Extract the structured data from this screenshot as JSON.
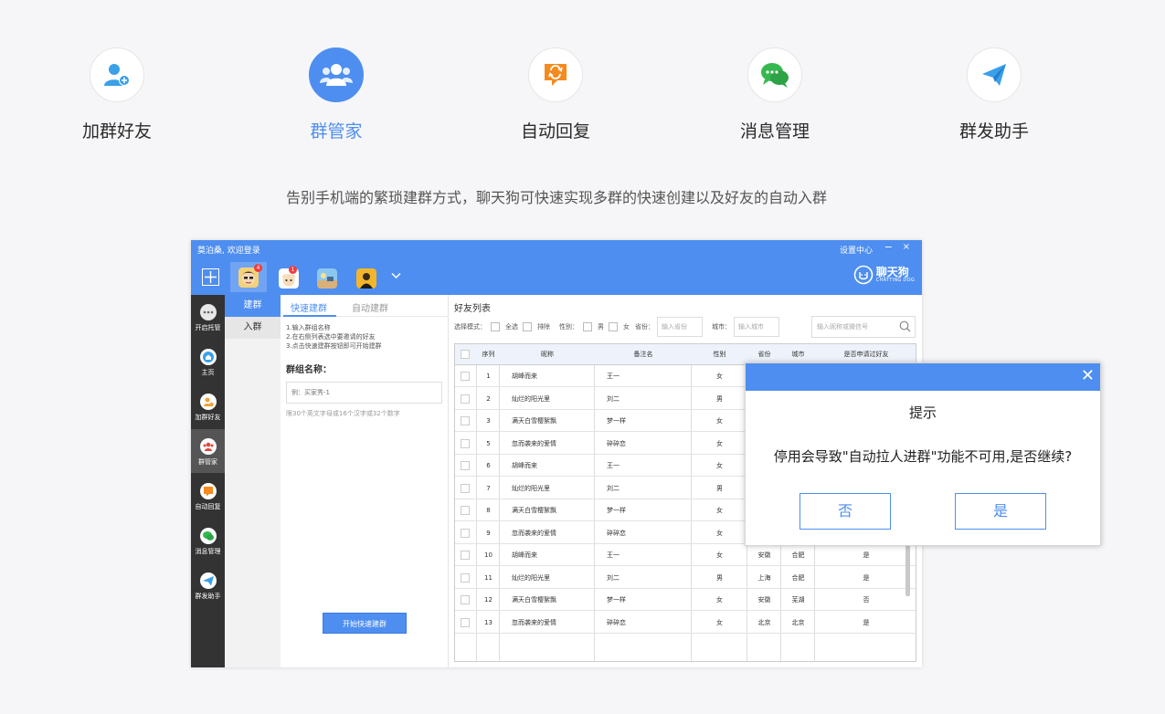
{
  "features": [
    {
      "label": "加群好友",
      "icon": "add-friend-icon",
      "active": false
    },
    {
      "label": "群管家",
      "icon": "group-manager-icon",
      "active": true
    },
    {
      "label": "自动回复",
      "icon": "auto-reply-icon",
      "active": false
    },
    {
      "label": "消息管理",
      "icon": "message-icon",
      "active": false
    },
    {
      "label": "群发助手",
      "icon": "paper-plane-icon",
      "active": false
    }
  ],
  "tagline": "告别手机端的繁琐建群方式，聊天狗可快速实现多群的快速创建以及好友的自动入群",
  "window": {
    "title": "莫泊桑, 欢迎登录",
    "settings": "设置中心",
    "min": "−",
    "close": "×",
    "logo_text": "聊天狗",
    "logo_sub": "CHATTING DOG",
    "accounts": [
      {
        "badge": "4",
        "selected": true
      },
      {
        "badge": "1",
        "selected": false
      },
      {
        "badge": "",
        "selected": false
      },
      {
        "badge": "",
        "selected": false
      }
    ]
  },
  "sidebar": [
    {
      "label": "开启托管",
      "icon": "ellipsis-icon",
      "selected": false
    },
    {
      "label": "主页",
      "icon": "home-icon",
      "selected": false
    },
    {
      "label": "加群好友",
      "icon": "add-friend-icon",
      "selected": false
    },
    {
      "label": "群管家",
      "icon": "group-manager-icon",
      "selected": true
    },
    {
      "label": "自动回复",
      "icon": "auto-reply-icon",
      "selected": false
    },
    {
      "label": "消息管理",
      "icon": "message-icon",
      "selected": false
    },
    {
      "label": "群发助手",
      "icon": "paper-plane-icon",
      "selected": false
    }
  ],
  "submenu": [
    {
      "label": "建群",
      "selected": true
    },
    {
      "label": "入群",
      "selected": false
    }
  ],
  "create": {
    "tab_fast": "快速建群",
    "tab_auto": "自动建群",
    "step1": "1.输入群组名称",
    "step2": "2.在右侧列表选中要邀请的好友",
    "step3": "3.点击快速建群按钮即可开始建群",
    "group_name_label": "群组名称：",
    "group_name_placeholder": "例：买家秀-1",
    "hint": "限30个英文字母或16个汉字或32个数字",
    "start_button": "开始快速建群"
  },
  "friends": {
    "title": "好友列表",
    "mode_label": "选择模式：",
    "select_all": "全选",
    "exclude": "排除",
    "gender_label": "性别：",
    "male": "男",
    "female": "女",
    "province_label": "省份：",
    "province_placeholder": "输入省份",
    "city_label": "城市：",
    "city_placeholder": "输入城市",
    "search_placeholder": "输入昵称或微信号",
    "columns": [
      "序列",
      "昵称",
      "备注名",
      "性别",
      "省份",
      "城市",
      "是否申请过好友"
    ],
    "rows": [
      {
        "seq": "1",
        "nick": "胡峰而来",
        "remark": "王一",
        "gender": "女"
      },
      {
        "seq": "2",
        "nick": "灿烂的阳光里",
        "remark": "刘二",
        "gender": "男"
      },
      {
        "seq": "3",
        "nick": "满天白雪樱絮飘",
        "remark": "梦一样",
        "gender": "女"
      },
      {
        "seq": "5",
        "nick": "忽而袭来的爱情",
        "remark": "碎碎恋",
        "gender": "女"
      },
      {
        "seq": "6",
        "nick": "胡峰而来",
        "remark": "王一",
        "gender": "女"
      },
      {
        "seq": "7",
        "nick": "灿烂的阳光里",
        "remark": "刘二",
        "gender": "男"
      },
      {
        "seq": "8",
        "nick": "满天白雪樱絮飘",
        "remark": "梦一样",
        "gender": "女"
      },
      {
        "seq": "9",
        "nick": "忽而袭来的爱情",
        "remark": "碎碎恋",
        "gender": "女"
      },
      {
        "seq": "10",
        "nick": "胡峰而来",
        "remark": "王一",
        "gender": "女",
        "province": "安徽",
        "city": "合肥",
        "applied": "是"
      },
      {
        "seq": "11",
        "nick": "灿烂的阳光里",
        "remark": "刘二",
        "gender": "男",
        "province": "上海",
        "city": "合肥",
        "applied": "是"
      },
      {
        "seq": "12",
        "nick": "满天白雪樱絮飘",
        "remark": "梦一样",
        "gender": "女",
        "province": "安徽",
        "city": "芜湖",
        "applied": "否"
      },
      {
        "seq": "13",
        "nick": "忽而袭来的爱情",
        "remark": "碎碎恋",
        "gender": "女",
        "province": "北京",
        "city": "北京",
        "applied": "是"
      }
    ]
  },
  "dialog": {
    "close": "✕",
    "title": "提示",
    "message": "停用会导致\"自动拉人进群\"功能不可用,是否继续?",
    "no": "否",
    "yes": "是"
  },
  "colors": {
    "accent": "#4e8ef0",
    "sidebar_bg": "#333333",
    "page_bg": "#f6f6f8"
  }
}
